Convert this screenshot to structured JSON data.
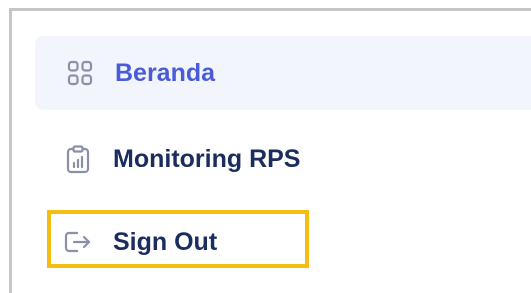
{
  "menu": {
    "items": [
      {
        "label": "Beranda",
        "icon": "grid-icon",
        "active": true
      },
      {
        "label": "Monitoring RPS",
        "icon": "clipboard-chart-icon",
        "active": false
      },
      {
        "label": "Sign Out",
        "icon": "sign-out-icon",
        "active": false
      }
    ]
  },
  "colors": {
    "active_text": "#4a5bd8",
    "text": "#1b2d5e",
    "active_bg": "#f3f5fc",
    "highlight": "#f5bc12"
  }
}
